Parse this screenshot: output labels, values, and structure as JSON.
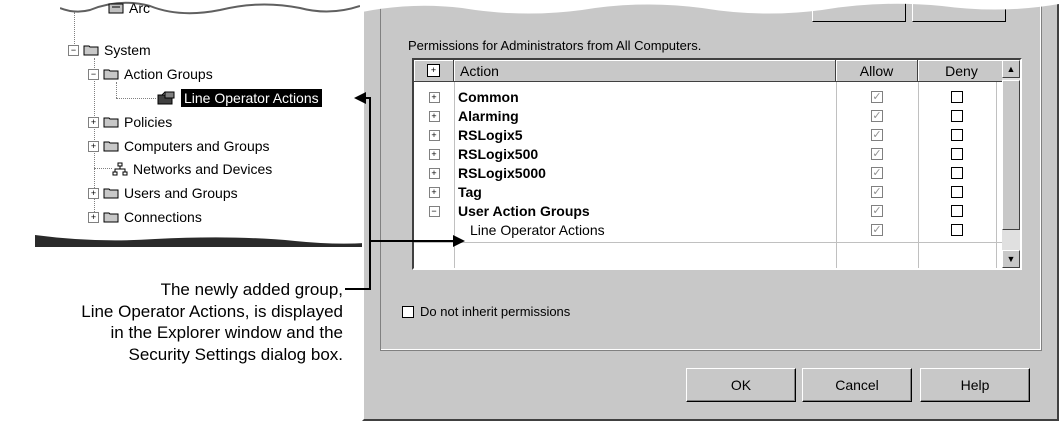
{
  "tree": {
    "items": [
      {
        "label": "Arc",
        "indent": 3
      },
      {
        "label": "System",
        "indent": 1
      },
      {
        "label": "Action Groups",
        "indent": 2
      },
      {
        "label": "Line Operator Actions",
        "indent": 3,
        "selected": true
      },
      {
        "label": "Policies",
        "indent": 2
      },
      {
        "label": "Computers and Groups",
        "indent": 2
      },
      {
        "label": "Networks and Devices",
        "indent": 2
      },
      {
        "label": "Users and Groups",
        "indent": 2
      },
      {
        "label": "Connections",
        "indent": 2
      }
    ]
  },
  "dialog": {
    "caption": "Permissions for Administrators from All Computers.",
    "columns": {
      "expand": "⊞",
      "action": "Action",
      "allow": "Allow",
      "deny": "Deny"
    },
    "rows": [
      {
        "expander": "+",
        "action": "Common",
        "allow": true,
        "deny": false
      },
      {
        "expander": "+",
        "action": "Alarming",
        "allow": true,
        "deny": false
      },
      {
        "expander": "+",
        "action": "RSLogix5",
        "allow": true,
        "deny": false
      },
      {
        "expander": "+",
        "action": "RSLogix500",
        "allow": true,
        "deny": false
      },
      {
        "expander": "+",
        "action": "RSLogix5000",
        "allow": true,
        "deny": false
      },
      {
        "expander": "+",
        "action": "Tag",
        "allow": true,
        "deny": false
      },
      {
        "expander": "−",
        "action": "User Action Groups",
        "allow": true,
        "deny": false
      },
      {
        "expander": "",
        "action": "Line Operator Actions",
        "allow": true,
        "deny": false,
        "child": true
      }
    ],
    "inherit_label": "Do not inherit permissions",
    "buttons": {
      "ok": "OK",
      "cancel": "Cancel",
      "help": "Help"
    }
  },
  "callout": {
    "line1": "The newly added group,",
    "line2": "Line Operator Actions, is displayed",
    "line3": "in the Explorer window and the",
    "line4": "Security Settings dialog box."
  },
  "colors": {
    "dialog_bg": "#c8c8c8",
    "selection": "#000000"
  }
}
